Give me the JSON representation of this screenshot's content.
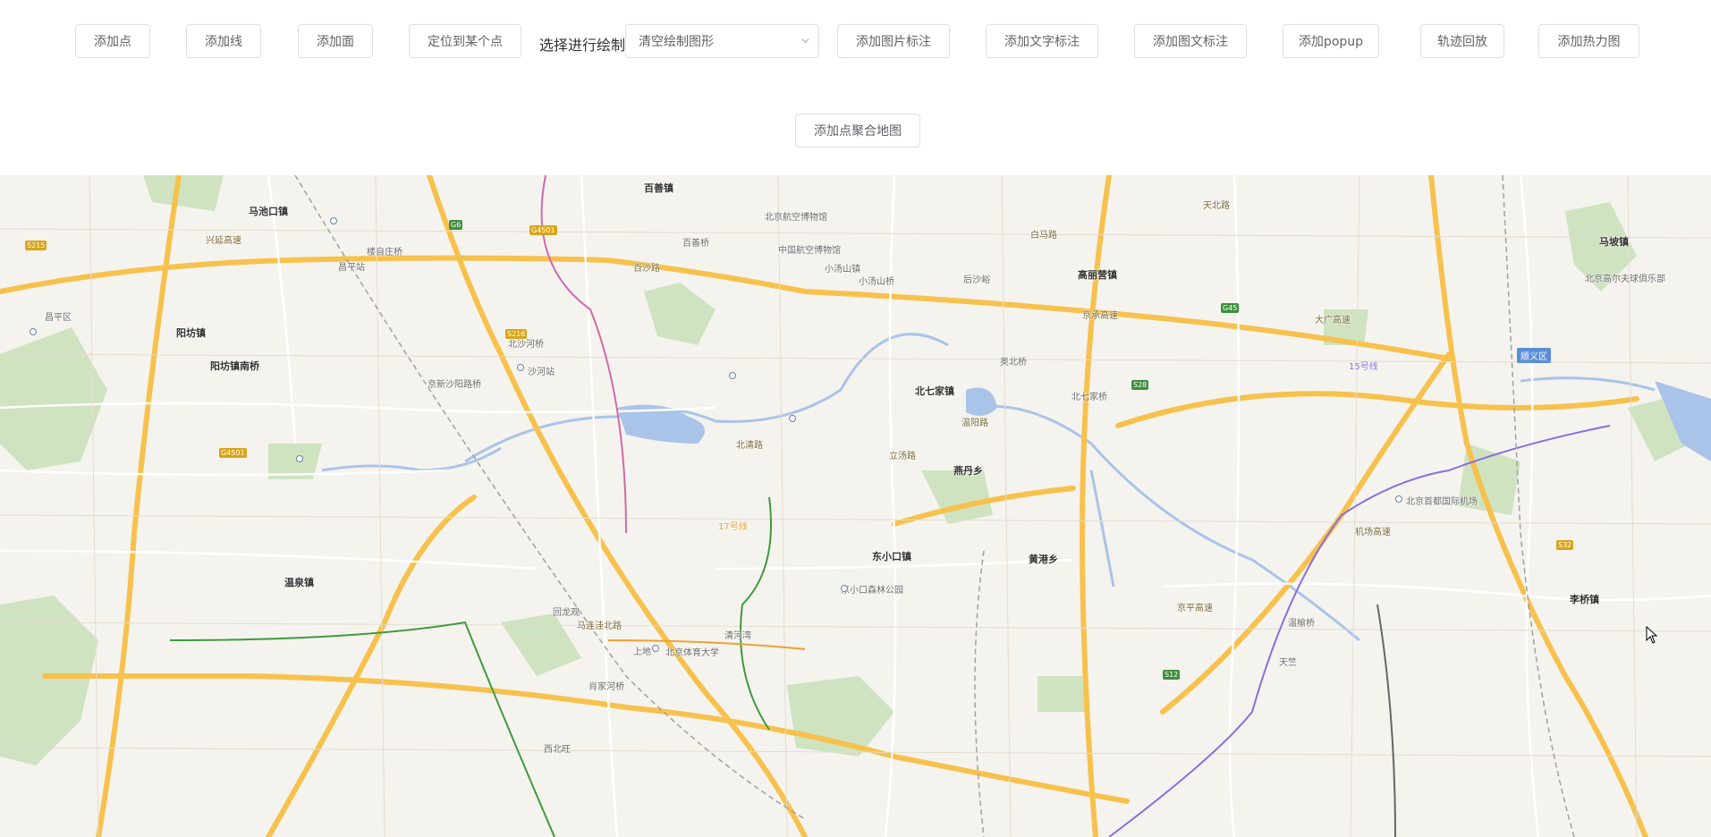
{
  "toolbar": {
    "add_point": "添加点",
    "add_line": "添加线",
    "add_polygon": "添加面",
    "locate_point": "定位到某个点",
    "draw_label": "选择进行绘制",
    "draw_select": "清空绘制图形",
    "add_image_marker": "添加图片标注",
    "add_text_marker": "添加文字标注",
    "add_image_text_marker": "添加图文标注",
    "add_popup": "添加popup",
    "track_playback": "轨迹回放",
    "add_heatmap": "添加热力图",
    "add_cluster_map": "添加点聚合地图"
  },
  "colors": {
    "map_bg": "#f5f3ee",
    "road": "#f7c14d",
    "water": "#a9c4e8",
    "green": "#c8dfb8",
    "subway_green": "#3f9a3f",
    "subway_purple": "#8a6ee0"
  },
  "icons": {
    "select_arrow": "chevron-down-icon",
    "cursor": "mouse-pointer-icon"
  },
  "map": {
    "towns": [
      {
        "name": "阳坊镇",
        "id": "t1"
      },
      {
        "name": "马池口镇",
        "id": "t2"
      },
      {
        "name": "百善镇",
        "id": "t3"
      },
      {
        "name": "北七家镇",
        "id": "t4"
      },
      {
        "name": "高丽营镇",
        "id": "t5"
      },
      {
        "name": "马坡镇",
        "id": "t6"
      },
      {
        "name": "燕丹乡",
        "id": "t7"
      },
      {
        "name": "东小口镇",
        "id": "t8"
      },
      {
        "name": "黄港乡",
        "id": "t9"
      },
      {
        "name": "温泉镇",
        "id": "t10"
      },
      {
        "name": "李桥镇",
        "id": "t11"
      },
      {
        "name": "阳坊镇南桥",
        "id": "t12"
      }
    ],
    "labels": [
      "百善桥",
      "北沙河桥",
      "昌平站",
      "沙河站",
      "京新沙阳路桥",
      "北七家桥",
      "兴延高速",
      "楼自庄桥",
      "大广高速",
      "机场高速",
      "京承高速",
      "京平高速",
      "温榆桥",
      "东小口森林公园",
      "北京航空博物馆",
      "北京首都国际机场",
      "北京体育大学",
      "北清路",
      "天北路",
      "立汤路",
      "顺义区",
      "15号线",
      "17号线",
      "百沙路",
      "马连洼北路",
      "清河湾",
      "北京高尔夫球俱乐部",
      "中国航空博物馆",
      "小汤山镇",
      "小汤山桥",
      "白马路",
      "天竺",
      "西北旺",
      "奥北桥",
      "后沙峪",
      "回龙观",
      "上地",
      "肖家河桥",
      "温阳路",
      "昌平区"
    ],
    "shields": [
      "G6",
      "G4501",
      "G45",
      "S32",
      "S12",
      "G4501",
      "S28",
      "S215",
      "S216"
    ]
  }
}
